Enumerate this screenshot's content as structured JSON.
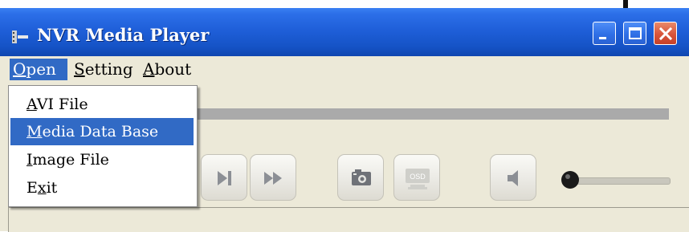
{
  "window": {
    "title": "NVR Media Player",
    "controls": {
      "minimize": "minimize",
      "maximize": "maximize",
      "close": "close"
    }
  },
  "menubar": {
    "open": {
      "access": "O",
      "rest": "pen"
    },
    "setting": {
      "access": "S",
      "rest": "etting"
    },
    "about": {
      "access": "A",
      "rest": "bout"
    }
  },
  "open_menu": {
    "items": [
      {
        "access": "A",
        "rest": "VI File"
      },
      {
        "access": "M",
        "rest": "edia Data Base",
        "highlighted": true
      },
      {
        "access": "I",
        "rest": "mage File"
      },
      {
        "pre": "E",
        "access": "x",
        "rest": "it"
      }
    ]
  },
  "player": {
    "osd_label": "OSD",
    "osd_enabled": false,
    "volume_level": 0
  },
  "colors": {
    "titlebar": "#1f5fd9",
    "menu_highlight": "#316ac5",
    "face": "#ece9d8",
    "close_button": "#d8543a"
  },
  "icons": [
    "app-icon",
    "minimize-icon",
    "maximize-icon",
    "close-icon",
    "next-frame-icon",
    "fast-forward-icon",
    "camera-icon",
    "osd-icon",
    "speaker-icon"
  ]
}
